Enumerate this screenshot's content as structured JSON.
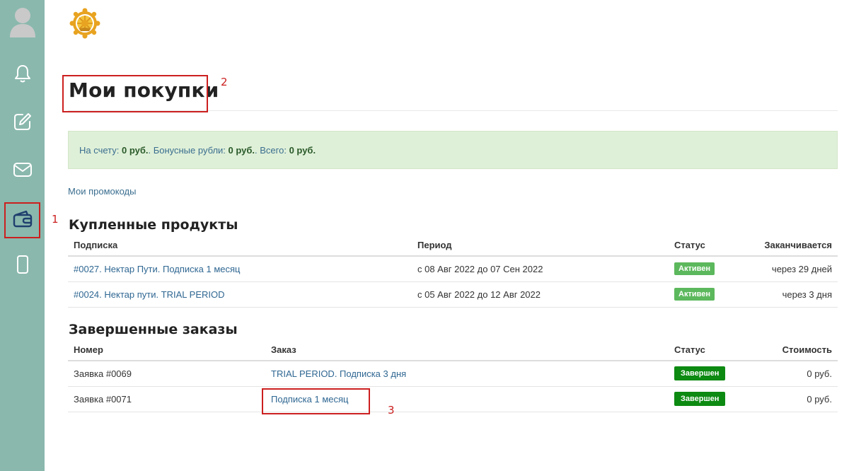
{
  "sidebar": {
    "items": [
      {
        "icon": "avatar-icon"
      },
      {
        "icon": "bell-icon"
      },
      {
        "icon": "edit-icon"
      },
      {
        "icon": "mail-icon"
      },
      {
        "icon": "wallet-icon"
      },
      {
        "icon": "phone-icon"
      }
    ],
    "active_color": "#1f3f6e"
  },
  "annotations": {
    "n1": "1",
    "n2": "2",
    "n3": "3"
  },
  "page": {
    "title": "Мои покупки"
  },
  "balance": {
    "account_label": "На счету:",
    "account_value": "0 руб.",
    "bonus_label": ". Бонусные рубли:",
    "bonus_value": "0 руб.",
    "total_label": ". Всего:",
    "total_value": "0 руб."
  },
  "promo_link": "Мои промокоды",
  "purchased": {
    "title": "Купленные продукты",
    "headers": {
      "subscription": "Подписка",
      "period": "Период",
      "status": "Статус",
      "ends": "Заканчивается"
    },
    "rows": [
      {
        "name": "#0027. Нектар Пути. Подписка 1 месяц",
        "period": "с 08 Авг 2022 до 07 Сен 2022",
        "status": "Активен",
        "ends": "через 29 дней"
      },
      {
        "name": "#0024. Нектар пути. TRIAL PERIOD",
        "period": "с 05 Авг 2022 до 12 Авг 2022",
        "status": "Активен",
        "ends": "через 3 дня"
      }
    ]
  },
  "completed": {
    "title": "Завершенные заказы",
    "headers": {
      "number": "Номер",
      "order": "Заказ",
      "status": "Статус",
      "cost": "Стоимость"
    },
    "rows": [
      {
        "number": "Заявка #0069",
        "order": "TRIAL PERIOD. Подписка 3 дня",
        "status": "Завершен",
        "cost": "0 руб."
      },
      {
        "number": "Заявка #0071",
        "order": "Подписка 1 месяц",
        "status": "Завершен",
        "cost": "0 руб."
      }
    ]
  },
  "colors": {
    "sidebar_bg": "#8ab8ad",
    "balance_bg": "#dff0d8",
    "link": "#2f6792",
    "badge_active": "#5cb85c",
    "badge_done": "#0d8a12",
    "annotation": "#cc1f1f"
  }
}
